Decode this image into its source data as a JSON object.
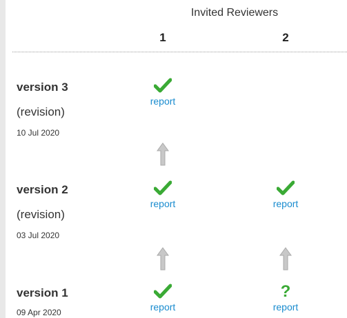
{
  "header": {
    "title": "Invited Reviewers",
    "columns": [
      "1",
      "2"
    ]
  },
  "versions": [
    {
      "label": "version 3",
      "status": "(revision)",
      "date": "10 Jul 2020",
      "reviews": [
        {
          "icon": "check-icon",
          "link": "report"
        }
      ]
    },
    {
      "label": "version 2",
      "status": "(revision)",
      "date": "03 Jul 2020",
      "reviews": [
        {
          "icon": "check-icon",
          "link": "report"
        },
        {
          "icon": "check-icon",
          "link": "report"
        }
      ]
    },
    {
      "label": "version 1",
      "date": "09 Apr 2020",
      "reviews": [
        {
          "icon": "check-icon",
          "link": "report"
        },
        {
          "icon": "question-icon",
          "link": "report"
        }
      ]
    }
  ],
  "colors": {
    "check": "#3aaa35",
    "link": "#1a8ccf",
    "arrow": "#c8c8c8"
  }
}
